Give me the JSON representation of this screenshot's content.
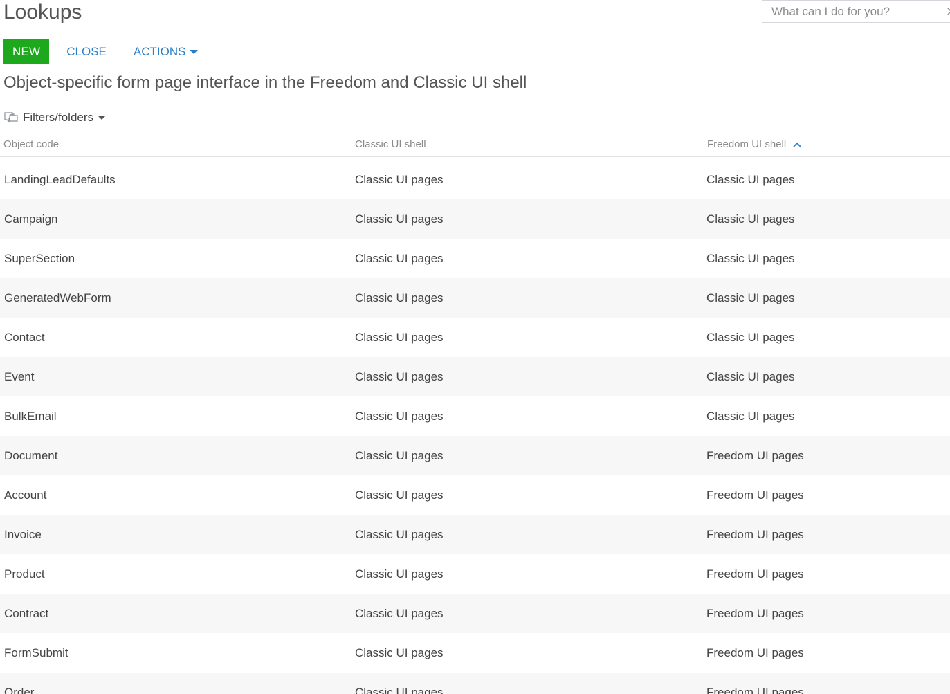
{
  "header": {
    "title": "Lookups",
    "command_placeholder": "What can I do for you?",
    "clear_glyph": "✕"
  },
  "toolbar": {
    "new_label": "NEW",
    "close_label": "CLOSE",
    "actions_label": "ACTIONS"
  },
  "colors": {
    "new_button": "#1ea81e",
    "link": "#2c7ec5",
    "row_alt": "#f7f7f7"
  },
  "subtitle": "Object-specific form page interface in the Freedom and Classic UI shell",
  "filters": {
    "label": "Filters/folders",
    "icon": "filter-folder-icon"
  },
  "grid": {
    "columns": [
      {
        "label": "Object code"
      },
      {
        "label": "Classic UI shell"
      },
      {
        "label": "Freedom UI shell",
        "sort": "ascending"
      }
    ],
    "rows": [
      {
        "code": "LandingLeadDefaults",
        "classic": "Classic UI pages",
        "freedom": "Classic UI pages"
      },
      {
        "code": "Campaign",
        "classic": "Classic UI pages",
        "freedom": "Classic UI pages"
      },
      {
        "code": "SuperSection",
        "classic": "Classic UI pages",
        "freedom": "Classic UI pages"
      },
      {
        "code": "GeneratedWebForm",
        "classic": "Classic UI pages",
        "freedom": "Classic UI pages"
      },
      {
        "code": "Contact",
        "classic": "Classic UI pages",
        "freedom": "Classic UI pages"
      },
      {
        "code": "Event",
        "classic": "Classic UI pages",
        "freedom": "Classic UI pages"
      },
      {
        "code": "BulkEmail",
        "classic": "Classic UI pages",
        "freedom": "Classic UI pages"
      },
      {
        "code": "Document",
        "classic": "Classic UI pages",
        "freedom": "Freedom UI pages"
      },
      {
        "code": "Account",
        "classic": "Classic UI pages",
        "freedom": "Freedom UI pages"
      },
      {
        "code": "Invoice",
        "classic": "Classic UI pages",
        "freedom": "Freedom UI pages"
      },
      {
        "code": "Product",
        "classic": "Classic UI pages",
        "freedom": "Freedom UI pages"
      },
      {
        "code": "Contract",
        "classic": "Classic UI pages",
        "freedom": "Freedom UI pages"
      },
      {
        "code": "FormSubmit",
        "classic": "Classic UI pages",
        "freedom": "Freedom UI pages"
      },
      {
        "code": "Order",
        "classic": "Classic UI pages",
        "freedom": "Freedom UI pages"
      }
    ]
  }
}
